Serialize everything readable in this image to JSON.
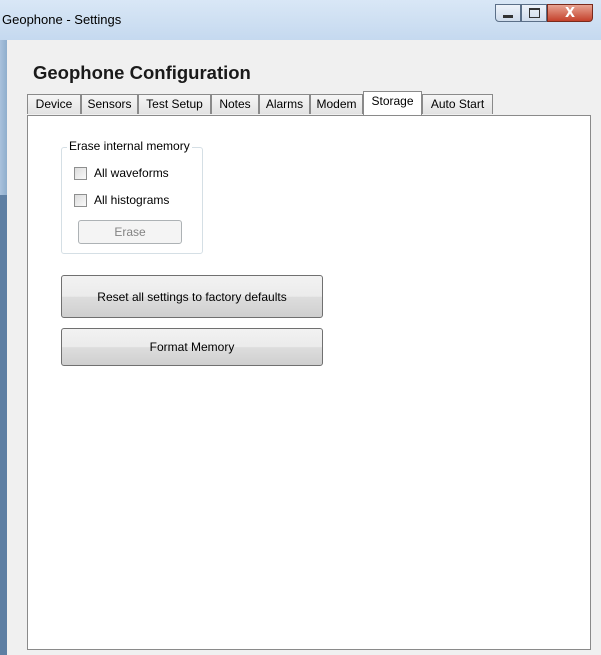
{
  "window": {
    "title": "Geophone - Settings",
    "buttons": {
      "minimize_icon": "minimize-icon",
      "maximize_icon": "maximize-icon",
      "close_icon": "close-icon",
      "close_glyph": "X"
    },
    "accent_color": "#c4412b"
  },
  "main": {
    "heading": "Geophone Configuration",
    "tabs": [
      {
        "label": "Device"
      },
      {
        "label": "Sensors"
      },
      {
        "label": "Test Setup"
      },
      {
        "label": "Notes"
      },
      {
        "label": "Alarms"
      },
      {
        "label": "Modem"
      },
      {
        "label": "Storage",
        "active": true
      },
      {
        "label": "Auto Start"
      }
    ]
  },
  "storage": {
    "erase_group": {
      "label": "Erase internal memory",
      "checkboxes": [
        {
          "label": "All waveforms",
          "checked": false
        },
        {
          "label": "All histograms",
          "checked": false
        }
      ],
      "erase_button": "Erase",
      "erase_enabled": false
    },
    "reset_button": "Reset all settings to factory defaults",
    "format_button": "Format Memory"
  }
}
